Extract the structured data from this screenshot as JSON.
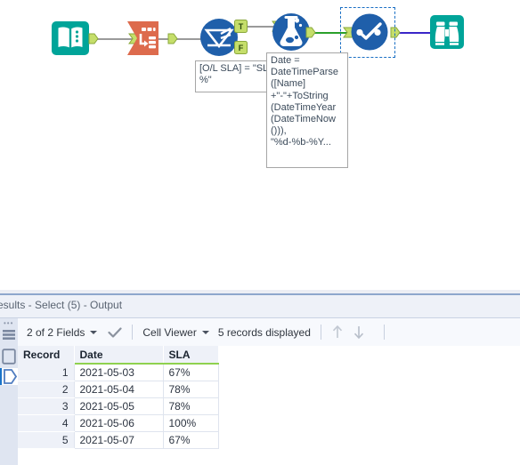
{
  "canvas": {
    "tools": [
      {
        "id": "input-data",
        "name": "input-data-tool",
        "icon": "book-icon",
        "color": "#00a499"
      },
      {
        "id": "select-1",
        "name": "select-tool",
        "icon": "select-icon",
        "color": "#dd6b4d"
      },
      {
        "id": "filter",
        "name": "filter-tool",
        "icon": "filter-icon",
        "color": "#1f5faa"
      },
      {
        "id": "formula",
        "name": "formula-tool",
        "icon": "flask-icon",
        "color": "#1f5faa"
      },
      {
        "id": "select-5",
        "name": "select-tool-5",
        "icon": "check-circle-icon",
        "color": "#1f5faa"
      },
      {
        "id": "browse",
        "name": "browse-tool",
        "icon": "binoculars-icon",
        "color": "#00a499"
      }
    ],
    "filter_outputs": {
      "true_label": "T",
      "false_label": "F"
    },
    "annotations": {
      "filter_expression": "[O/L SLA] = \"SL\n%\"",
      "formula_expression": "Date =\nDateTimeParse\n([Name]\n+\"-\"+ToString\n(DateTimeYear\n(DateTimeNow\n())),\n\"%d-%b-%Y..."
    },
    "wire_colors": {
      "default": "#9a9a9a",
      "formula_to_select": "#2aa02a",
      "select_to_browse": "#3a26c8"
    },
    "selection_color": "#1a6fc4"
  },
  "results": {
    "title": "esults - Select (5) - Output",
    "rail": {
      "items": [
        {
          "name": "rail-grip",
          "glyph": "•••"
        },
        {
          "name": "rail-item-messages",
          "icon": "list-icon"
        },
        {
          "name": "rail-item-table",
          "icon": "table-icon"
        },
        {
          "name": "rail-item-data",
          "icon": "hexagon-icon"
        }
      ]
    },
    "toolbar": {
      "fields_label": "2 of 2 Fields",
      "check_icon": "checkmark-icon",
      "viewer_label": "Cell Viewer",
      "records_label": "5 records displayed",
      "up_arrow_icon": "arrow-up-icon",
      "down_arrow_icon": "arrow-down-icon"
    },
    "table": {
      "columns": [
        "Record",
        "Date",
        "SLA"
      ],
      "rows": [
        {
          "record": "1",
          "date": "2021-05-03",
          "sla": "67%"
        },
        {
          "record": "2",
          "date": "2021-05-04",
          "sla": "78%"
        },
        {
          "record": "3",
          "date": "2021-05-05",
          "sla": "78%"
        },
        {
          "record": "4",
          "date": "2021-05-06",
          "sla": "100%"
        },
        {
          "record": "5",
          "date": "2021-05-07",
          "sla": "67%"
        }
      ],
      "header_underline_color": "#8fd14f"
    }
  }
}
